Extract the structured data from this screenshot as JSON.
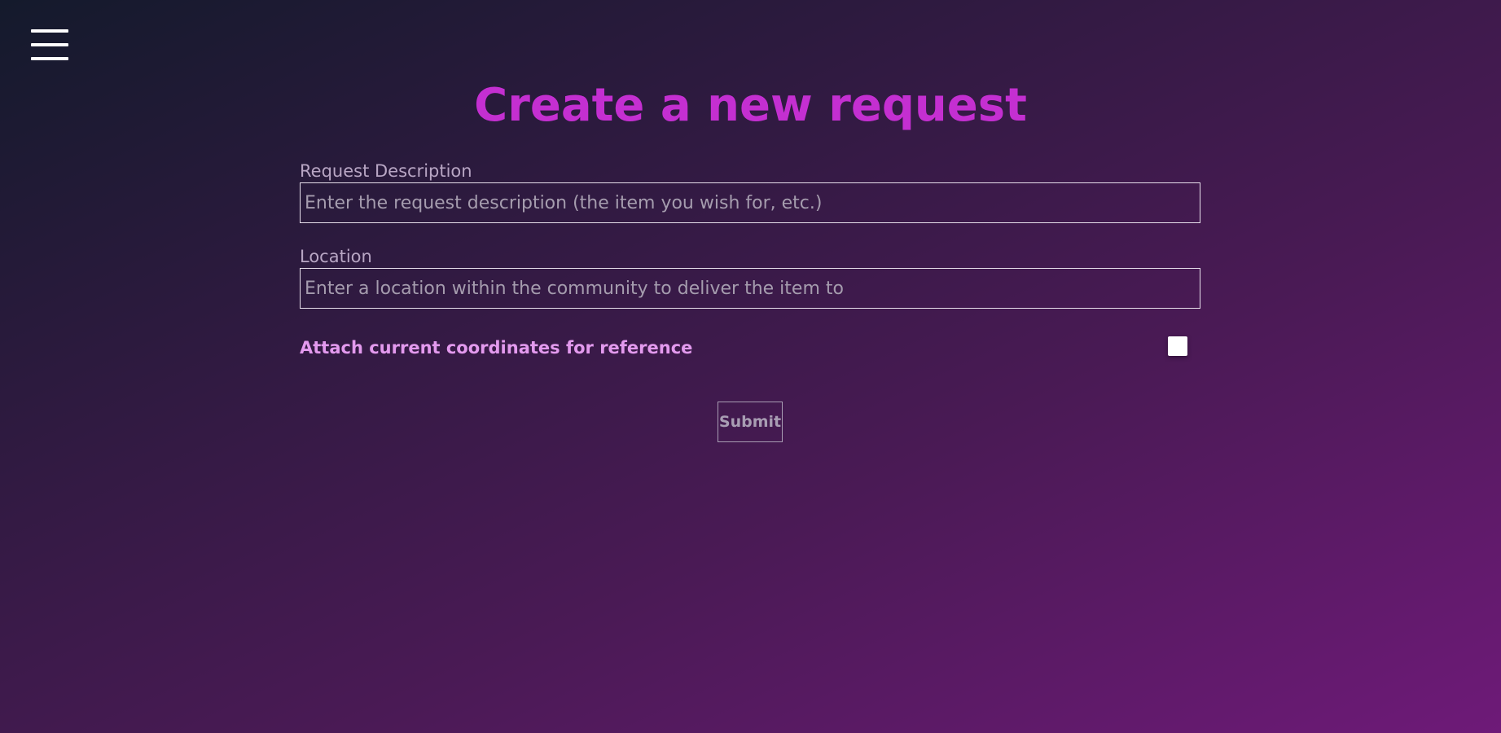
{
  "header": {
    "menu_icon": "hamburger-menu-icon"
  },
  "page": {
    "title": "Create a new request"
  },
  "form": {
    "description": {
      "label": "Request Description",
      "placeholder": "Enter the request description (the item you wish for, etc.)",
      "value": ""
    },
    "location": {
      "label": "Location",
      "placeholder": "Enter a location within the community to deliver the item to",
      "value": ""
    },
    "coordinates": {
      "label": "Attach current coordinates for reference",
      "checked": false
    },
    "submit_label": "Submit"
  },
  "colors": {
    "title": "#c42fd1",
    "checkbox_label": "#e39aee",
    "background_start": "#141a2c",
    "background_end": "#6e1a78"
  }
}
